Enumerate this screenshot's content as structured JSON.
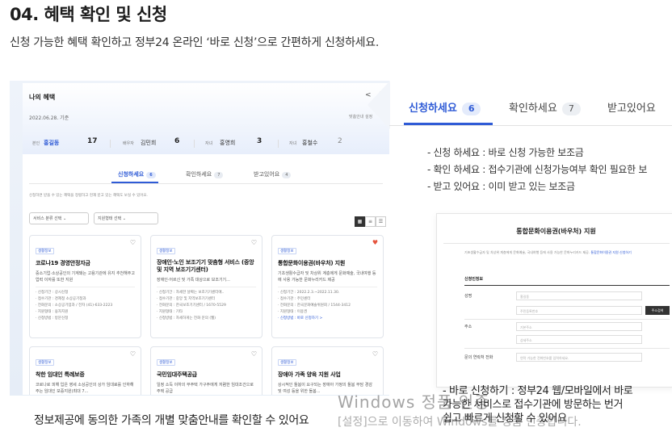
{
  "heading": "04. 혜택 확인 및 신청",
  "subheading": "신청 가능한 혜택 확인하고 정부24 온라인 ‘바로 신청’으로 간편하게 신청하세요.",
  "panel": {
    "title": "나의 혜택",
    "date": "2022.06.28. 기준",
    "guide": "맞춤안내 설정",
    "members": [
      {
        "role": "본인",
        "name": "홍길동",
        "count": "17"
      },
      {
        "role": "배우자",
        "name": "김민희",
        "count": "6"
      },
      {
        "role": "자녀",
        "name": "홍영희",
        "count": "3"
      },
      {
        "role": "자녀",
        "name": "홍철수",
        "count": "2"
      }
    ],
    "tabs": [
      {
        "label": "신청하세요",
        "count": "6"
      },
      {
        "label": "확인하세요",
        "count": "7"
      },
      {
        "label": "받고있어요",
        "count": "4"
      }
    ],
    "note": "신청하면 받을 수 있는 혜택을 정렬하고 현재 받고 있는 혜택도 보실 수 있어요.",
    "filter_category": "서비스 분류 선택",
    "filter_agency": "지원형태 선택",
    "cards": [
      {
        "tag": "생활정보",
        "title": "코로나19 경영안정자금",
        "desc": "중소기업·소상공인의 기계돼는 고용기관에 유지 추천해주고 업력 이자를 또한 지원",
        "lines": [
          "· 신청기간 : 상시신청",
          "· 접수기관 : 경제청 소상공기청과",
          "· 전화문의 : 소상공기업과 / 전자 (41)-633-2223",
          "· 지원형태 : 융자지원",
          "· 신청방법 : 방문신청"
        ]
      },
      {
        "tag": "생활정보",
        "title": "장애인·노인 보조기기 맞춤형 서비스 (중앙 및 지역 보조기기센터)",
        "desc": "장애인·어르신 및 가족 대상으로 보조기기...",
        "lines": [
          "· 신청기간 : 자세한 날짜는 보조기기센터에..",
          "· 접수기관 : 중앙 및 지역보조기기센터",
          "· 전화문의 : 한국보조기기센터 / 1670-5529",
          "· 지원형태 : 기타",
          "· 신청방법 : 자세하게는 전화 문의 (웹)"
        ]
      },
      {
        "tag": "생활정보",
        "title": "통합문화이용권(바우처) 지원",
        "desc": "기초생활수급자 및 차상위 계층에게 문화예술, 국내여행 등에 사용 가능한 문화누리카드 제공",
        "lines": [
          "· 신청기간 : 2022.2.3.~2022.11.30.",
          "· 접수기관 : 주민센터",
          "· 전화문의 : 한국문화예술위원회 / 1544-3412",
          "· 지원형태 : 이용권",
          "· 신청방법 : 바로 신청하기 >"
        ],
        "liked": true
      },
      {
        "tag": "생활정보",
        "title": "착한 임대인 특례보증",
        "desc": "코로나로 피해 입은 영세 소상공인의 상가 임대료를 인하해주는 임대인 보증지원(최대 7...",
        "lines": []
      },
      {
        "tag": "생활정보",
        "title": "국민임대주택공급",
        "desc": "일정 소득 이하의 무주택 가구주에게 저렴한 임대조건으로 주택 공급",
        "lines": []
      },
      {
        "tag": "생활정보",
        "title": "장애아 가족 양육 지원 사업",
        "desc": "상시적인 돌봄이 요구되는 장애아 가정의 돌봄 부담 경감 및 여성 등을 위한 돌봄...",
        "lines": []
      }
    ]
  },
  "zoom": {
    "tabs": [
      {
        "label": "신청하세요",
        "count": "6"
      },
      {
        "label": "확인하세요",
        "count": "7"
      },
      {
        "label": "받고있어요",
        "count": ""
      }
    ],
    "descriptions": [
      "- 신청 하세요 : 바로 신청 가능한 보조금",
      "- 확인 하세요 : 접수기관에 신청가능여부 확인 필요한 보",
      "- 받고 있어요 : 이미 받고 있는 보조금"
    ],
    "detail": {
      "title": "통합문화이용권(바우처) 지원",
      "note": "기초생활수급자 및 차상위 계층에게 문화예술, 국내여행 등에 사용 가능한 문화누리카드 제공.",
      "note_link": "통합문화이용권 지원 신청하기",
      "section": "신청인정보",
      "fields": [
        {
          "label": "성명",
          "placeholder": "홍길동"
        },
        {
          "label": "",
          "placeholder": "주민등록번호"
        },
        {
          "label": "주소",
          "placeholder": "기본주소"
        },
        {
          "label": "",
          "placeholder": "상세주소"
        },
        {
          "label": "문의 연락처 전화",
          "placeholder": "연락 가능한 전화번호를 입력하세요."
        }
      ],
      "search_button": "주소검색"
    }
  },
  "bottom_right": [
    "- 바로 신청하기 : 정부24 웹/모바일에서 바로",
    "가능한 서비스로 접수기관에 방문하는 번거",
    "쉽고 빠르게 신청할 수 있어요"
  ],
  "bottom_left": "정보제공에 동의한 가족의 개별 맞춤안내를 확인할 수 있어요",
  "watermark": {
    "line1": "Windows 정품 인증",
    "line2": "[설정]으로 이동하여 Windows를 정품 인증합니다."
  }
}
